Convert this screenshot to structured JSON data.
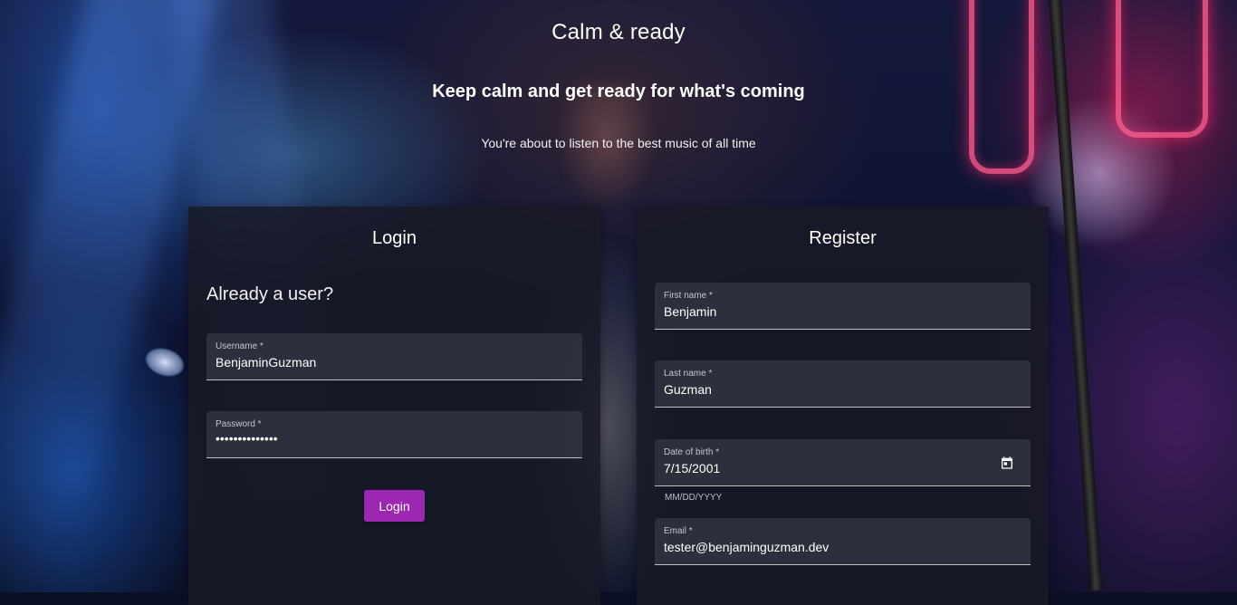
{
  "hero": {
    "title": "Calm & ready",
    "subtitle": "Keep calm and get ready for what's coming",
    "tagline": "You're about to listen to the best music of all time"
  },
  "login": {
    "title": "Login",
    "prompt": "Already a user?",
    "username": {
      "label": "Username *",
      "value": "BenjaminGuzman"
    },
    "password": {
      "label": "Password *",
      "value": "••••••••••••••"
    },
    "submit_label": "Login",
    "accent": "#9c27b0"
  },
  "register": {
    "title": "Register",
    "first_name": {
      "label": "First name *",
      "value": "Benjamin"
    },
    "last_name": {
      "label": "Last name *",
      "value": "Guzman"
    },
    "dob": {
      "label": "Date of birth *",
      "value": "7/15/2001",
      "hint": "MM/DD/YYYY",
      "icon": "calendar-icon"
    },
    "email": {
      "label": "Email *",
      "value": "tester@benjaminguzman.dev"
    }
  }
}
